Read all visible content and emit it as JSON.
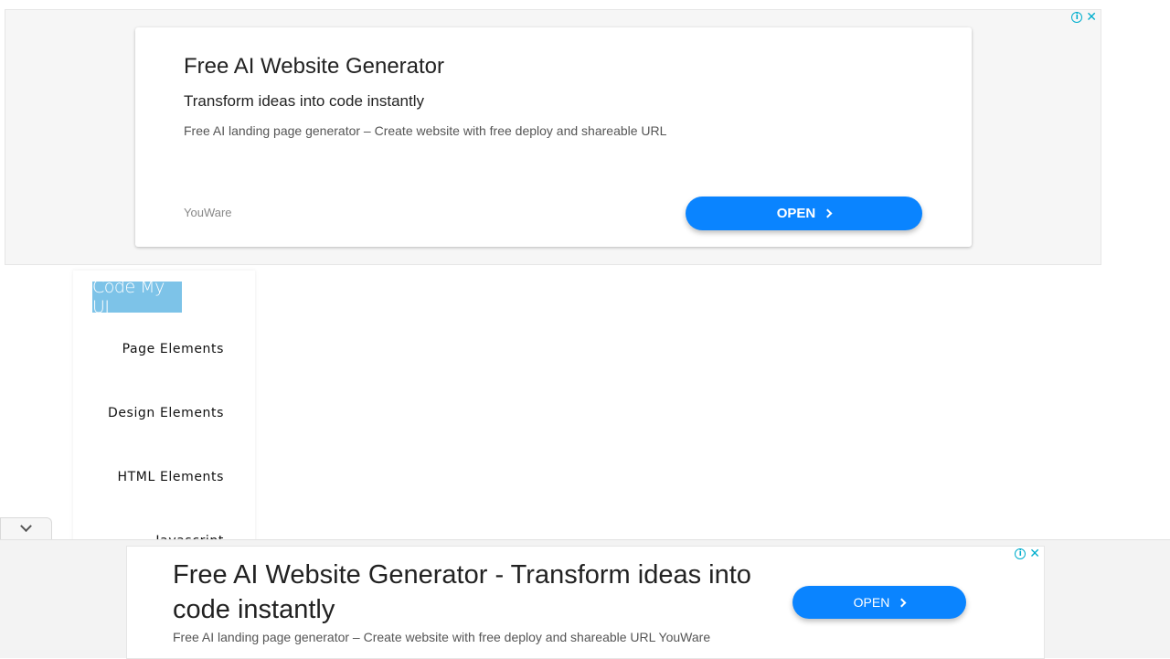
{
  "top_ad": {
    "title": "Free AI Website Generator",
    "subtitle": "Transform ideas into code instantly",
    "description": "Free AI landing page generator – Create website with free deploy and shareable URL",
    "brand": "YouWare",
    "cta_label": "OPEN",
    "info_icon": "ⓘ",
    "close_icon": "✕"
  },
  "sidebar": {
    "logo_text": "Code My UI",
    "items": [
      {
        "label": "Page Elements"
      },
      {
        "label": "Design Elements"
      },
      {
        "label": "HTML Elements"
      },
      {
        "label": "Javascript"
      }
    ]
  },
  "bottom_ad": {
    "title": "Free AI Website Generator - Transform ideas into code instantly",
    "description": "Free AI landing page generator – Create website with free deploy and shareable URL YouWare",
    "cta_label": "OPEN",
    "info_icon": "ⓘ",
    "close_icon": "✕"
  },
  "colors": {
    "accent_blue": "#0a84ff",
    "logo_bg": "#7dc3e8",
    "ad_icon": "#00aecd"
  }
}
